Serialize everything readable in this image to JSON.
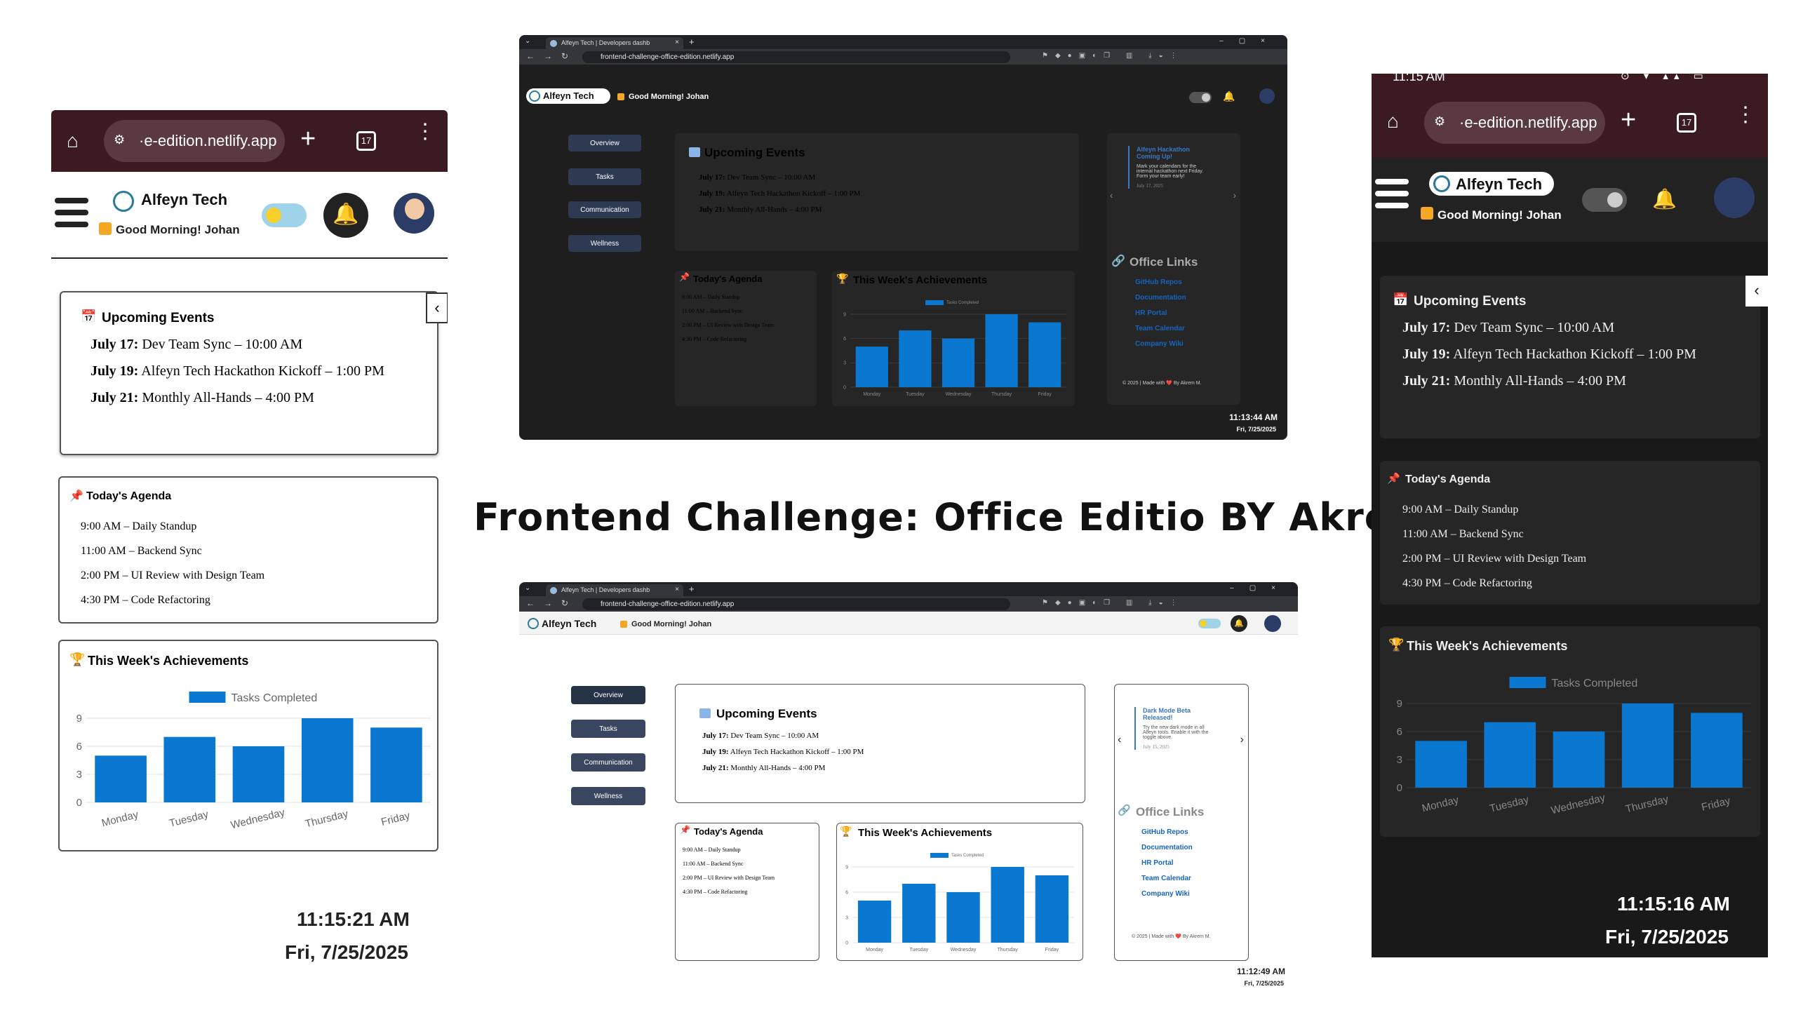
{
  "title": "Frontend Challenge: Office Editio BY Akrem Muktar",
  "brand": {
    "name": "Alfeyn Tech",
    "greeting": "Good Morning! Johan"
  },
  "colors": {
    "accent": "#0a78d0",
    "dark_bg": "#1e1e1e",
    "card_dark": "#262626",
    "link": "#1565c0"
  },
  "browser": {
    "tab_title": "Alfeyn Tech | Developers dashb",
    "url": "frontend-challenge-office-edition.netlify.app",
    "mobile_url": "·e-edition.netlify.app",
    "tab_count": "17"
  },
  "sidebar": {
    "items": [
      "Overview",
      "Tasks",
      "Communication",
      "Wellness"
    ]
  },
  "events": {
    "heading": "Upcoming Events",
    "items": [
      {
        "date": "July 17:",
        "text": "Dev Team Sync – 10:00 AM"
      },
      {
        "date": "July 19:",
        "text": "Alfeyn Tech Hackathon Kickoff – 1:00 PM"
      },
      {
        "date": "July 21:",
        "text": "Monthly All-Hands – 4:00 PM"
      }
    ]
  },
  "agenda": {
    "heading": "Today's Agenda",
    "items": [
      "9:00 AM – Daily Standup",
      "11:00 AM – Backend Sync",
      "2:00 PM – UI Review with Design Team",
      "4:30 PM – Code Refactoring"
    ]
  },
  "achievements": {
    "heading": "This Week's Achievements",
    "legend": "Tasks Completed"
  },
  "chart_data": {
    "type": "bar",
    "categories": [
      "Monday",
      "Tuesday",
      "Wednesday",
      "Thursday",
      "Friday"
    ],
    "series": [
      {
        "name": "Tasks Completed",
        "values": [
          5,
          7,
          6,
          9,
          8
        ]
      }
    ],
    "yticks": [
      "9",
      "6",
      "3",
      "0"
    ],
    "ylim": [
      0,
      9
    ]
  },
  "announce": {
    "dark": {
      "title": "Alfeyn Hackathon Coming Up!",
      "body": "Mark your calendars for the internal hackathon next Friday. Form your team early!",
      "date": "July 17, 2025"
    },
    "light": {
      "title": "Dark Mode Beta Released!",
      "body": "Try the new dark mode in all Alfeyn tools. Enable it with the toggle above.",
      "date": "July 15, 2025"
    }
  },
  "office_links": {
    "heading": "Office Links",
    "items": [
      "GitHub Repos",
      "Documentation",
      "HR Portal",
      "Team Calendar",
      "Company Wiki"
    ]
  },
  "footer": "© 2025 | Made with ❤️ By Akrem M.",
  "clocks": {
    "dark_desktop": {
      "time": "11:13:44 AM",
      "date": "Fri, 7/25/2025"
    },
    "light_desktop": {
      "time": "11:12:49 AM",
      "date": "Fri, 7/25/2025"
    },
    "light_mobile": {
      "time": "11:15:21 AM",
      "date": "Fri, 7/25/2025"
    },
    "dark_mobile": {
      "time": "11:15:16 AM",
      "date": "Fri, 7/25/2025",
      "status": "11:15 AM"
    }
  }
}
